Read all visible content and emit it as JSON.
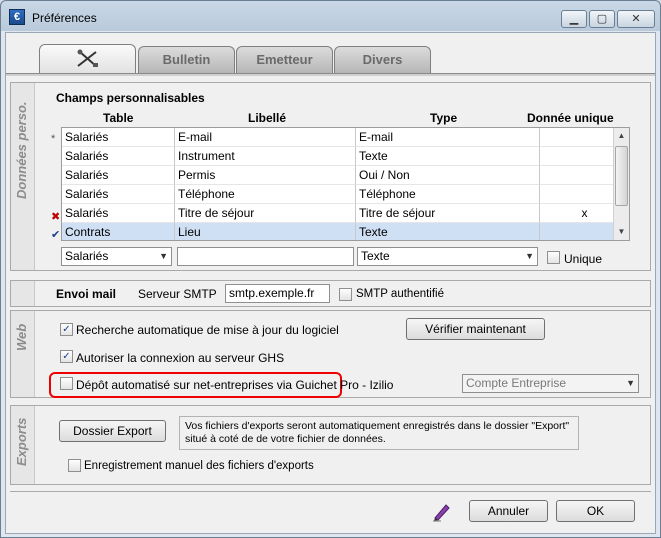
{
  "window": {
    "title": "Préférences",
    "icon": "app-icon"
  },
  "tabs": [
    {
      "label": "",
      "icon": "tools-icon",
      "active": true
    },
    {
      "label": "Bulletin"
    },
    {
      "label": "Emetteur"
    },
    {
      "label": "Divers"
    }
  ],
  "sections": {
    "donnees": {
      "side_label": "Données perso.",
      "title": "Champs personnalisables",
      "columns": [
        "Table",
        "Libellé",
        "Type",
        "Donnée unique"
      ],
      "rows": [
        {
          "table": "Salariés",
          "libelle": "E-mail",
          "type": "E-mail",
          "unique": ""
        },
        {
          "table": "Salariés",
          "libelle": "Instrument",
          "type": "Texte",
          "unique": ""
        },
        {
          "table": "Salariés",
          "libelle": "Permis",
          "type": "Oui / Non",
          "unique": ""
        },
        {
          "table": "Salariés",
          "libelle": "Téléphone",
          "type": "Téléphone",
          "unique": ""
        },
        {
          "table": "Salariés",
          "libelle": "Titre de séjour",
          "type": "Titre de séjour",
          "unique": "x"
        },
        {
          "table": "Contrats",
          "libelle": "Lieu",
          "type": "Texte",
          "unique": ""
        }
      ],
      "editor": {
        "table_value": "Salariés",
        "libelle_value": "",
        "type_value": "Texte",
        "unique_label": "Unique"
      }
    },
    "mail": {
      "title": "Envoi mail",
      "smtp_label": "Serveur SMTP",
      "smtp_value": "smtp.exemple.fr",
      "smtp_auth_label": "SMTP authentifié"
    },
    "web": {
      "side_label": "Web",
      "auto_update_label": "Recherche automatique de mise à jour du logiciel",
      "verify_button": "Vérifier maintenant",
      "ghs_label": "Autoriser la connexion au serveur GHS",
      "depot_label": "Dépôt automatisé sur net-entreprises via Guichet Pro - Izilio",
      "account_value": "Compte Entreprise"
    },
    "exports": {
      "side_label": "Exports",
      "folder_button": "Dossier Export",
      "note": "Vos fichiers d'exports seront automatiquement enregistrés dans le dossier \"Export\" situé à coté de de votre fichier de données.",
      "manual_label": "Enregistrement manuel des fichiers d'exports"
    }
  },
  "footer": {
    "cancel": "Annuler",
    "ok": "OK"
  }
}
